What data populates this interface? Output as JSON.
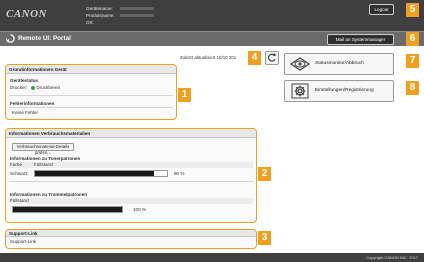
{
  "header": {
    "logo": "CANON",
    "device_labels": [
      "Gerätename:",
      "Produktname:",
      "Ort:"
    ],
    "logout_label": "Logout",
    "mail_label": "Mail an Systemmanager"
  },
  "title_bar": {
    "title": "Remote UI: Portal"
  },
  "updated_text": "Zuletzt aktualisiert 10/10 201",
  "callouts": [
    "1",
    "2",
    "3",
    "4",
    "5",
    "6",
    "7",
    "8"
  ],
  "basic_info": {
    "heading": "Grundinformationen Gerät",
    "device_status_title": "Gerätestatus",
    "printer_label": "Drucker:",
    "printer_status": "Druckbereit",
    "error_title": "Fehlerinformationen",
    "error_value": "Keine Fehler"
  },
  "consumables": {
    "heading": "Informationen Verbrauchsmaterialien",
    "details_button": "Verbrauchsmaterial-Details prüfen...",
    "toner_title": "Informationen zu Tonerpatronen",
    "col_color": "Farbe",
    "col_level": "Füllstand",
    "toner_color": "Schwarz",
    "toner_percent_label": "90 %",
    "toner_level": 0.9,
    "drum_title": "Informationen zu Trommelpatronen",
    "drum_col_level": "Füllstand",
    "drum_percent_label": "100 %",
    "drum_level": 1.0
  },
  "support": {
    "heading": "Support-Link",
    "link": "Support-Link"
  },
  "side_buttons": {
    "status_label": "Statusmonitor/Abbruch",
    "settings_label": "Einstellungen/Registrierung"
  },
  "footer": {
    "copyright": "Copyright CANON INC. 2017"
  },
  "colors": {
    "accent": "#f0a020",
    "topbar": "#3f3f3f",
    "ready_dot": "#2fa84f"
  }
}
